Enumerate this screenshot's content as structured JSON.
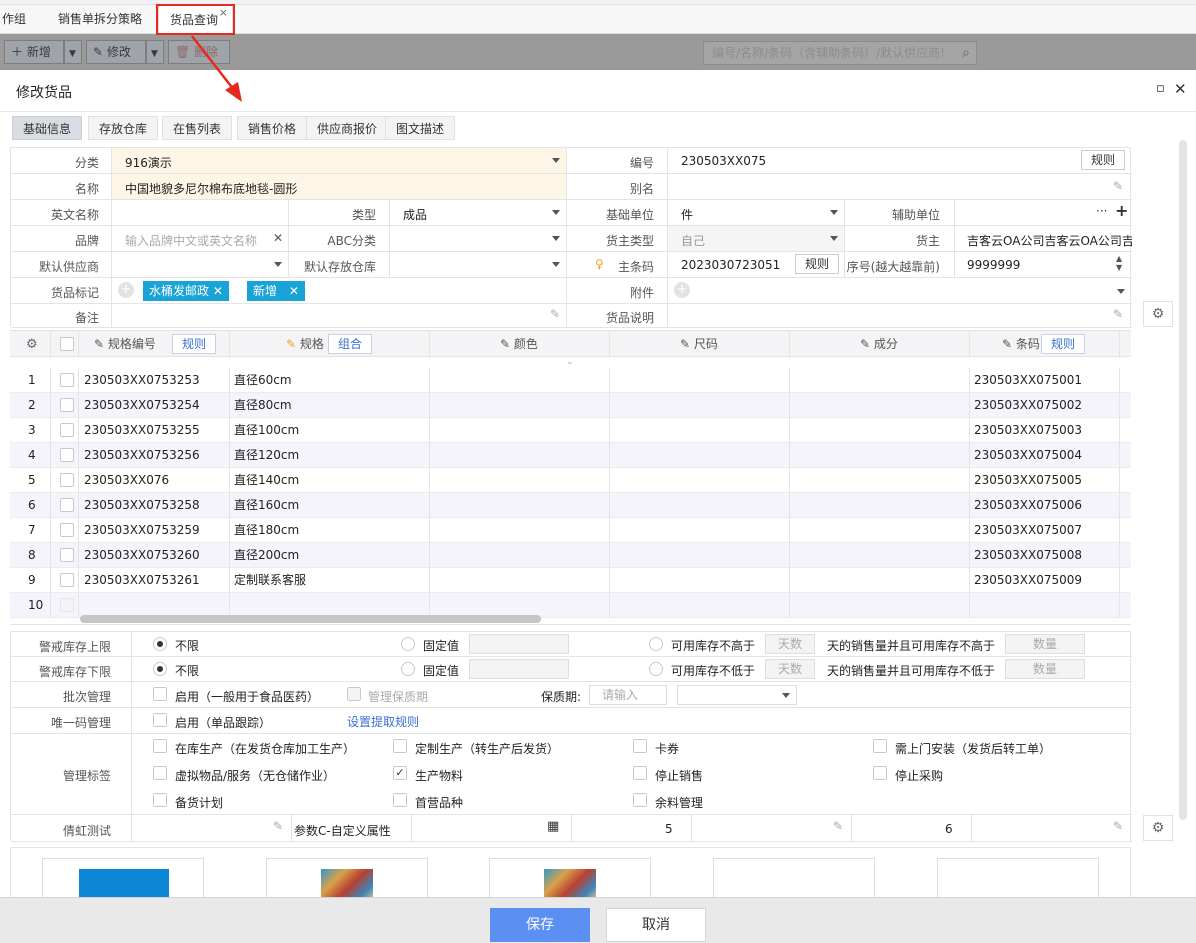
{
  "tabs": [
    {
      "label": "作组"
    },
    {
      "label": "销售单拆分策略"
    },
    {
      "label": "货品查询"
    }
  ],
  "tab_close": "×",
  "toolbar": {
    "add": "新增",
    "edit": "修改",
    "delete": "删除",
    "search_placeholder": "编号/名称/条码（含辅助条码）/默认供应商!"
  },
  "modal": {
    "title": "修改货品",
    "min": "▫",
    "close": "✕"
  },
  "subtabs": [
    {
      "label": "基础信息"
    },
    {
      "label": "存放仓库"
    },
    {
      "label": "在售列表"
    },
    {
      "label": "销售价格"
    },
    {
      "label": "供应商报价"
    },
    {
      "label": "图文描述"
    }
  ],
  "form": {
    "category_label": "分类",
    "category_value": "916演示",
    "code_label": "编号",
    "code_value": "230503XX075",
    "rule": "规则",
    "name_label": "名称",
    "name_value": "中国地貌多尼尔棉布底地毯-圆形",
    "alias_label": "别名",
    "en_label": "英文名称",
    "type_label": "类型",
    "type_value": "成品",
    "base_unit_label": "基础单位",
    "base_unit_value": "件",
    "aux_unit_label": "辅助单位",
    "more": "···",
    "plus": "+",
    "brand_label": "品牌",
    "brand_placeholder": "输入品牌中文或英文名称",
    "abc_label": "ABC分类",
    "owner_type_label": "货主类型",
    "owner_type_value": "自己",
    "owner_label": "货主",
    "owner_value": "吉客云OA公司吉客云OA公司吉",
    "supplier_label": "默认供应商",
    "warehouse_label": "默认存放仓库",
    "barcode_label": "主条码",
    "barcode_value": "2023030723051",
    "barcode_rule": "规则",
    "seq_label": "序号(越大越靠前)",
    "seq_value": "9999999",
    "mark_label": "货品标记",
    "tag1": "水桶发邮政",
    "tag2": "新增",
    "attach_label": "附件",
    "remark_label": "备注",
    "desc_label": "货品说明"
  },
  "grid": {
    "headers": {
      "spec_code": "规格编号",
      "spec_rule": "规则",
      "spec": "规格",
      "combo": "组合",
      "color": "颜色",
      "size": "尺码",
      "component": "成分",
      "barcode": "条码",
      "barcode_rule": "规则"
    },
    "rows": [
      {
        "n": "1",
        "code": "230503XX0753253",
        "spec": "直径60cm",
        "barcode": "230503XX075001"
      },
      {
        "n": "2",
        "code": "230503XX0753254",
        "spec": "直径80cm",
        "barcode": "230503XX075002"
      },
      {
        "n": "3",
        "code": "230503XX0753255",
        "spec": "直径100cm",
        "barcode": "230503XX075003"
      },
      {
        "n": "4",
        "code": "230503XX0753256",
        "spec": "直径120cm",
        "barcode": "230503XX075004"
      },
      {
        "n": "5",
        "code": "230503XX076",
        "spec": "直径140cm",
        "barcode": "230503XX075005"
      },
      {
        "n": "6",
        "code": "230503XX0753258",
        "spec": "直径160cm",
        "barcode": "230503XX075006"
      },
      {
        "n": "7",
        "code": "230503XX0753259",
        "spec": "直径180cm",
        "barcode": "230503XX075007"
      },
      {
        "n": "8",
        "code": "230503XX0753260",
        "spec": "直径200cm",
        "barcode": "230503XX075008"
      },
      {
        "n": "9",
        "code": "230503XX0753261",
        "spec": "定制联系客服",
        "barcode": "230503XX075009"
      },
      {
        "n": "10",
        "code": "",
        "spec": "",
        "barcode": ""
      }
    ]
  },
  "stock": {
    "upper_label": "警戒库存上限",
    "lower_label": "警戒库存下限",
    "unlimited": "不限",
    "fixed": "固定值",
    "upper_avail": "可用库存不高于",
    "lower_avail": "可用库存不低于",
    "days": "天数",
    "upper_tail": "天的销售量并且可用库存不高于",
    "lower_tail": "天的销售量并且可用库存不低于",
    "qty": "数量"
  },
  "batch": {
    "label": "批次管理",
    "enable": "启用（一般用于食品医药）",
    "shelf": "管理保质期",
    "period_label": "保质期:",
    "period_placeholder": "请输入"
  },
  "unique": {
    "label": "唯一码管理",
    "enable": "启用（单品跟踪）",
    "link": "设置提取规则"
  },
  "mgmt": {
    "label": "管理标签",
    "items": [
      {
        "text": "在库生产（在发货仓库加工生产）",
        "checked": false
      },
      {
        "text": "定制生产（转生产后发货）",
        "checked": false
      },
      {
        "text": "卡券",
        "checked": false
      },
      {
        "text": "需上门安装（发货后转工单）",
        "checked": false
      },
      {
        "text": "虚拟物品/服务（无仓储作业）",
        "checked": false
      },
      {
        "text": "生产物料",
        "checked": true
      },
      {
        "text": "停止销售",
        "checked": false
      },
      {
        "text": "停止采购",
        "checked": false
      },
      {
        "text": "备货计划",
        "checked": false
      },
      {
        "text": "首营品种",
        "checked": false
      },
      {
        "text": "余料管理",
        "checked": false
      }
    ]
  },
  "custom": {
    "label1": "倩虹测试",
    "label2": "参数C-自定义属性",
    "v1": "5",
    "v2": "6"
  },
  "footer": {
    "save": "保存",
    "cancel": "取消"
  },
  "colors": {
    "accent": "#5b8ff2",
    "tag": "#1aa3d6",
    "highlight": "#fdf5e6",
    "annotation": "#e8281f"
  }
}
